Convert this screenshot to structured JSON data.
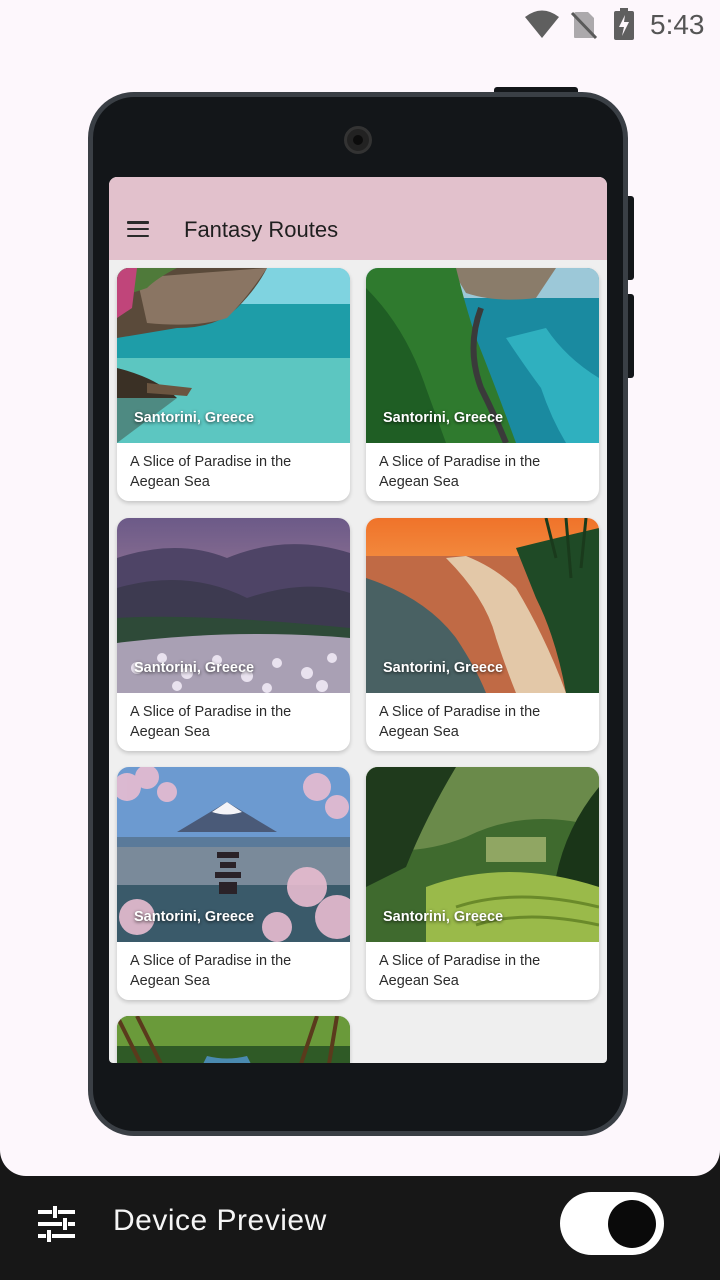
{
  "status_bar": {
    "time": "5:43",
    "icons": [
      "wifi-icon",
      "no-sim-icon",
      "battery-charging-icon"
    ]
  },
  "app": {
    "title": "Fantasy Routes",
    "menu_icon": "menu-icon",
    "cards": [
      {
        "location": "Santorini, Greece",
        "caption": "A Slice of Paradise in the Aegean Sea",
        "scene": "tropical-cove"
      },
      {
        "location": "Santorini, Greece",
        "caption": "A Slice of Paradise in the Aegean Sea",
        "scene": "coastal-road"
      },
      {
        "location": "Santorini, Greece",
        "caption": "A Slice of Paradise in the Aegean Sea",
        "scene": "mountain-flowers"
      },
      {
        "location": "Santorini, Greece",
        "caption": "A Slice of Paradise in the Aegean Sea",
        "scene": "sunset-beach"
      },
      {
        "location": "Santorini, Greece",
        "caption": "A Slice of Paradise in the Aegean Sea",
        "scene": "fuji-pagoda"
      },
      {
        "location": "Santorini, Greece",
        "caption": "A Slice of Paradise in the Aegean Sea",
        "scene": "rice-terraces"
      },
      {
        "location": "",
        "caption": "",
        "scene": "forest-river"
      }
    ]
  },
  "bottom_bar": {
    "title": "Device Preview",
    "settings_icon": "tune-icon",
    "toggle_on": true
  },
  "colors": {
    "appbar": "#e2c1cc",
    "outer_background": "#fdf7fc",
    "bottom_bar": "#171717"
  }
}
